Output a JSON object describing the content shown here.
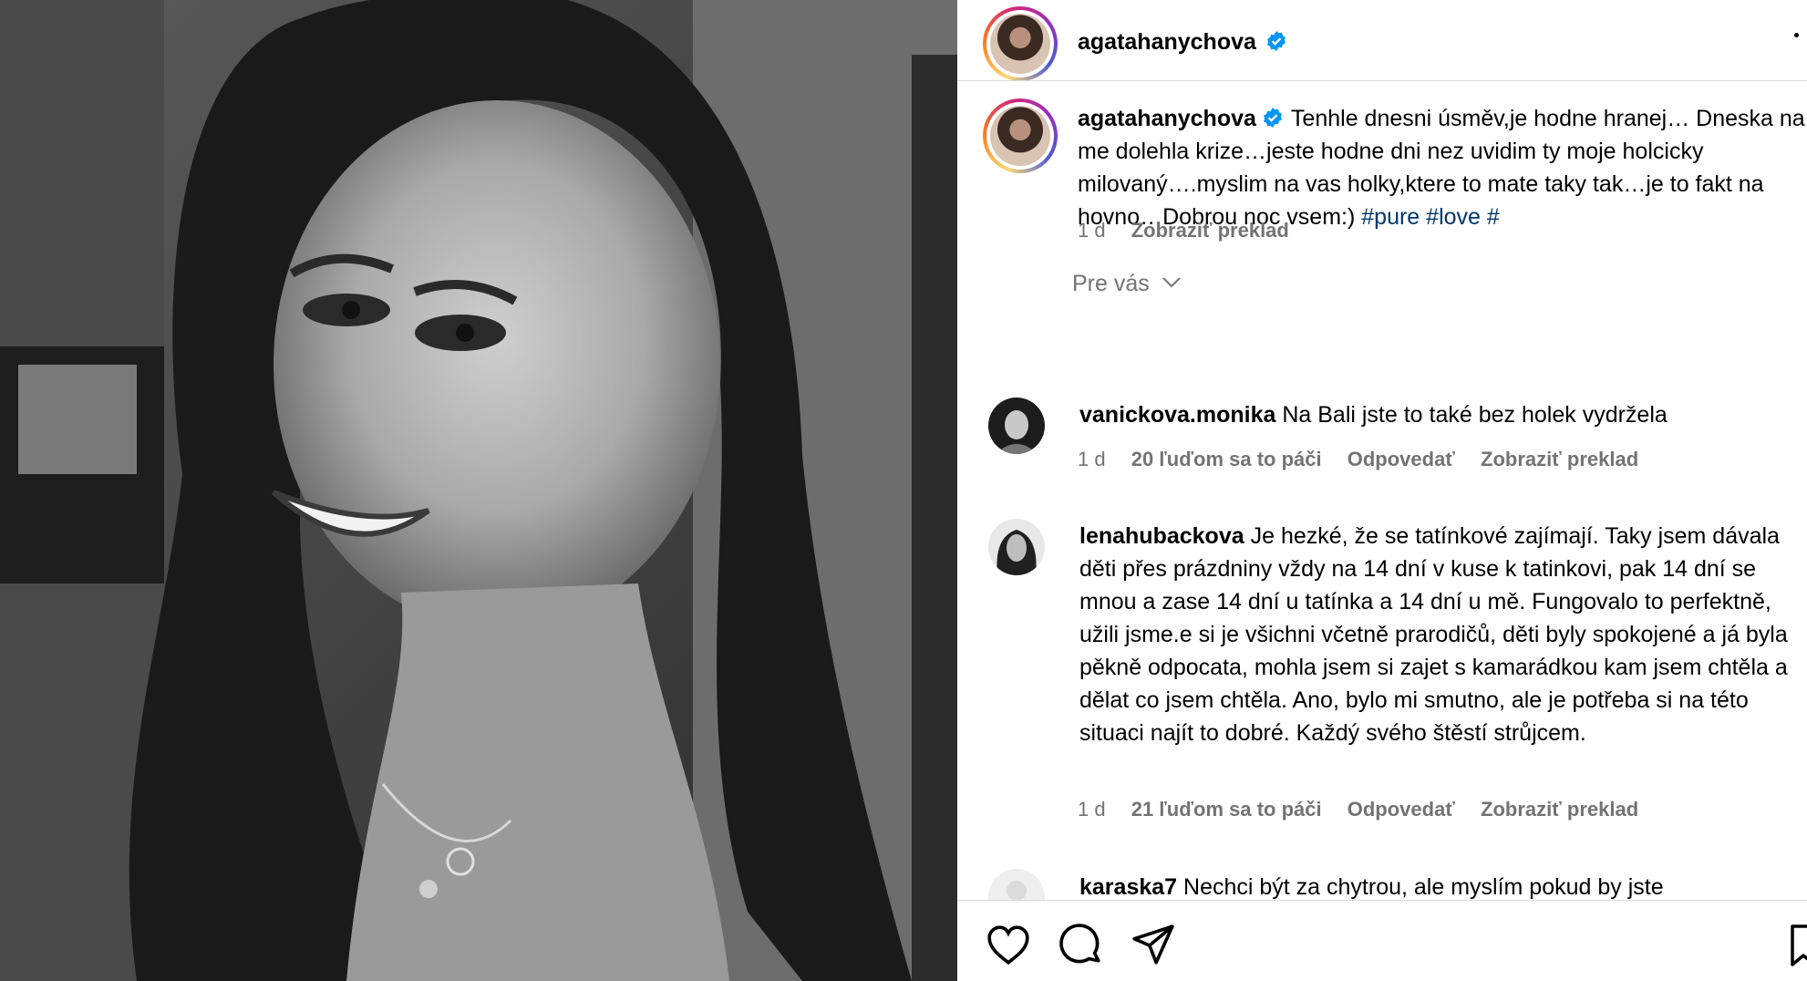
{
  "post": {
    "author": "agatahanychova",
    "verified": true
  },
  "caption": {
    "username": "agatahanychova",
    "text": "Tenhle dnesni úsměv,je hodne hranej… Dneska na me dolehla krize…jeste hodne dni nez uvidim ty moje holcicky milovaný….myslim na vas holky,ktere to mate taky tak…je to fakt na hovno…Dobrou noc vsem:) ",
    "hashtags": [
      "#pure",
      "#love",
      "#"
    ],
    "time": "1 d",
    "translate": "Zobraziť preklad"
  },
  "for_you": {
    "label": "Pre vás"
  },
  "comments": [
    {
      "username": "vanickova.monika",
      "text": "Na Bali jste to také bez holek vydržela",
      "time": "1 d",
      "likes": "20 ľuďom sa to páči",
      "reply": "Odpovedať",
      "translate": "Zobraziť preklad"
    },
    {
      "username": "lenahubackova",
      "text": "Je hezké, že se tatínkové zajímají. Taky jsem dávala děti přes prázdniny vždy na 14 dní v kuse k tatinkovi, pak 14 dní se mnou a zase 14 dní u tatínka a 14 dní u mě. Fungovalo to perfektně, užili jsme.e si je všichni včetně prarodičů, děti byly spokojené a já byla pěkně odpocata, mohla jsem si zajet s kamarádkou kam jsem chtěla a dělat co jsem chtěla. Ano, bylo mi smutno, ale je potřeba si na této situaci najít to dobré. Každý svého štěstí strůjcem.",
      "time": "1 d",
      "likes": "21 ľuďom sa to páči",
      "reply": "Odpovedať",
      "translate": "Zobraziť preklad"
    },
    {
      "username": "karaska7",
      "text": "Nechci být za chytrou, ale myslím pokud by jste"
    }
  ],
  "actions": {
    "like_icon": "heart-icon",
    "comment_icon": "comment-icon",
    "share_icon": "send-icon"
  },
  "colors": {
    "verified": "#0095f6",
    "hashtag": "#00376b",
    "meta": "#737373",
    "divider": "#dbdbdb"
  }
}
